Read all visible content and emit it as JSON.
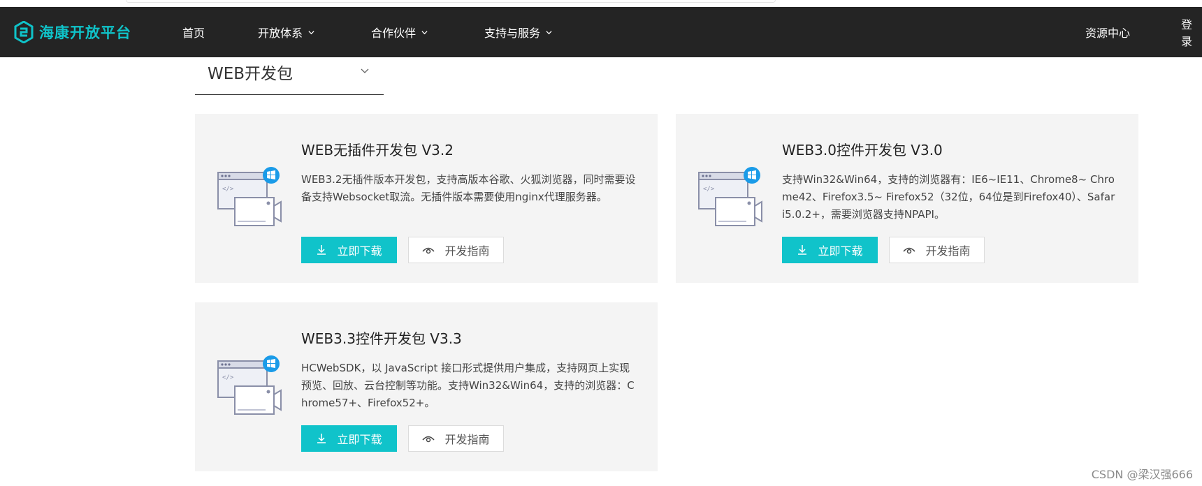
{
  "nav": {
    "logo_text": "海康开放平台",
    "items": [
      {
        "label": "首页",
        "has_dropdown": false
      },
      {
        "label": "开放体系",
        "has_dropdown": true
      },
      {
        "label": "合作伙伴",
        "has_dropdown": true
      },
      {
        "label": "支持与服务",
        "has_dropdown": true
      }
    ],
    "resources": "资源中心",
    "login": "登录"
  },
  "selector": {
    "label": "WEB开发包"
  },
  "cards": [
    {
      "title": "WEB无插件开发包 V3.2",
      "description": "WEB3.2无插件版本开发包，支持高版本谷歌、火狐浏览器，同时需要设备支持Websocket取流。无插件版本需要使用nginx代理服务器。",
      "download_label": "立即下载",
      "guide_label": "开发指南"
    },
    {
      "title": "WEB3.0控件开发包 V3.0",
      "description": "支持Win32&Win64，支持的浏览器有：IE6~IE11、Chrome8~ Chrome42、Firefox3.5~ Firefox52（32位，64位是到Firefox40）、Safari5.0.2+，需要浏览器支持NPAPI。",
      "download_label": "立即下载",
      "guide_label": "开发指南"
    },
    {
      "title": "WEB3.3控件开发包 V3.3",
      "description": "HCWebSDK，以 JavaScript 接口形式提供用户集成，支持网页上实现预览、回放、云台控制等功能。支持Win32&Win64，支持的浏览器：Chrome57+、Firefox52+。",
      "download_label": "立即下载",
      "guide_label": "开发指南"
    }
  ],
  "illustration": {
    "code_tag": "</>",
    "accent": "#1a9be8"
  },
  "colors": {
    "nav_bg": "#242424",
    "brand": "#0fc3c9",
    "download_bg": "#10c3ca",
    "card_bg": "#f4f4f4"
  },
  "watermark": "CSDN @梁汉强666"
}
